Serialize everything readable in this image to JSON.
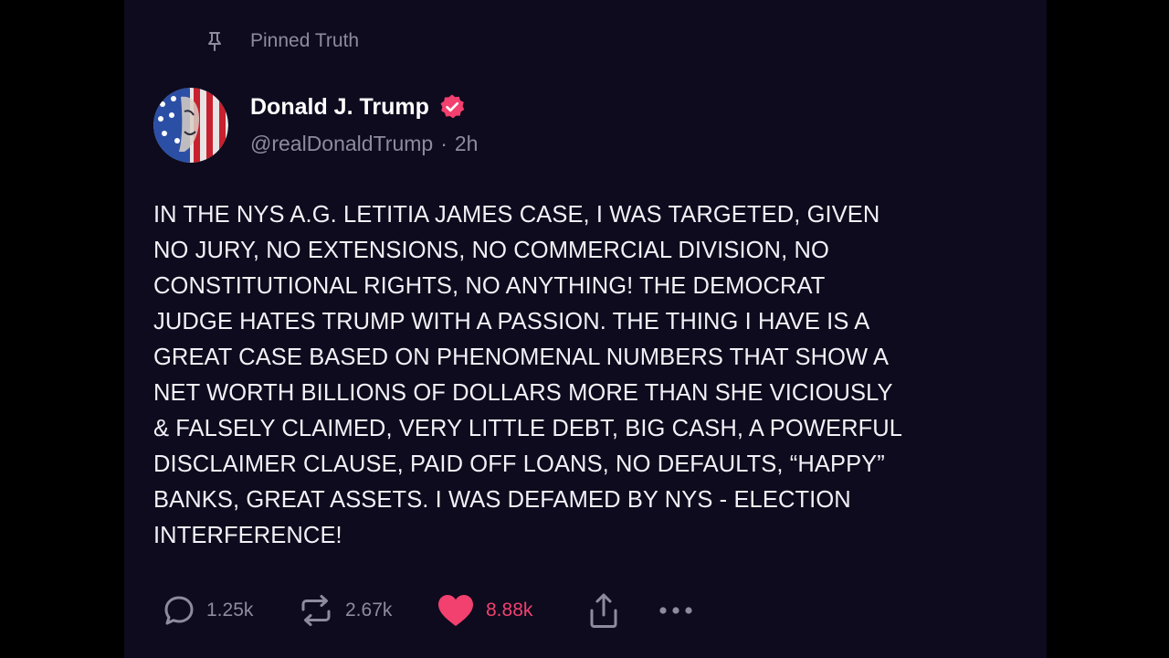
{
  "pinned": {
    "label": "Pinned Truth",
    "icon": "pin-icon"
  },
  "author": {
    "display_name": "Donald J. Trump",
    "handle": "@realDonaldTrump",
    "separator": "·",
    "time_ago": "2h",
    "verified_icon": "verified-badge-icon",
    "avatar_icon": "avatar"
  },
  "post": {
    "text": "IN THE NYS A.G. LETITIA JAMES CASE, I WAS TARGETED, GIVEN\nNO JURY, NO EXTENSIONS, NO COMMERCIAL DIVISION, NO\nCONSTITUTIONAL RIGHTS, NO ANYTHING! THE DEMOCRAT\nJUDGE HATES TRUMP WITH A PASSION. THE THING I HAVE IS A\nGREAT CASE BASED ON PHENOMENAL NUMBERS THAT SHOW A\nNET WORTH BILLIONS OF DOLLARS MORE THAN SHE VICIOUSLY\n& FALSELY CLAIMED, VERY LITTLE DEBT, BIG CASH, A POWERFUL\nDISCLAIMER CLAUSE, PAID OFF LOANS, NO DEFAULTS, “HAPPY”\nBANKS, GREAT ASSETS. I WAS DEFAMED BY NYS - ELECTION\nINTERFERENCE!"
  },
  "actions": {
    "reply": {
      "count": "1.25k",
      "icon": "reply-icon"
    },
    "retruth": {
      "count": "2.67k",
      "icon": "retruth-icon"
    },
    "like": {
      "count": "8.88k",
      "icon": "heart-icon"
    },
    "share": {
      "icon": "share-icon"
    },
    "more": {
      "icon": "more-options-icon"
    }
  },
  "colors": {
    "background": "#000000",
    "panel": "#0d0b1d",
    "text": "#f2f1f7",
    "muted": "#8e8b9e",
    "accent": "#f2406f"
  }
}
